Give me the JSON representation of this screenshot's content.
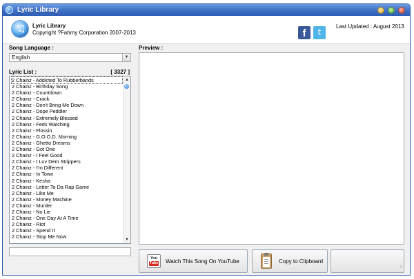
{
  "window": {
    "title": "Lyric Library"
  },
  "header": {
    "app_name": "Lyric Library",
    "copyright": "Copyright ?Fahmy Corporation 2007-2013",
    "facebook_glyph": "f",
    "twitter_glyph": "t",
    "last_updated": "Last Updated : August 2013"
  },
  "colors": {
    "title_bar": "#3d6fc6",
    "facebook": "#3b5998",
    "twitter": "#4fb4e8",
    "youtube_red": "#d62b22"
  },
  "icons": [
    "app-music-icon",
    "facebook-icon",
    "twitter-icon",
    "youtube-icon",
    "clipboard-icon",
    "minimize-icon",
    "maximize-icon",
    "close-icon"
  ],
  "language": {
    "label": "Song Language :",
    "selected": "English"
  },
  "lyric_list": {
    "label": "Lyric List :",
    "count": "[ 3327 ]",
    "items": [
      "2 Chainz - Addicted To Rubberbands",
      "2 Chainz - Birthday Song",
      "2 Chainz - Countdown",
      "2 Chainz - Crack",
      "2 Chainz - Don't Bring Me Down",
      "2 Chainz - Dope Peddler",
      "2 Chainz - Extremely Blessed",
      "2 Chainz - Feds Watching",
      "2 Chainz - Flossin",
      "2 Chainz - G.O.O.D. Morning",
      "2 Chainz - Ghetto Dreams",
      "2 Chainz - Got One",
      "2 Chainz - I Feel Good",
      "2 Chainz - I Luv Dem Strippers",
      "2 Chainz - I'm Different",
      "2 Chainz - In Town",
      "2 Chainz - Kesha",
      "2 Chainz - Letter To Da Rap Game",
      "2 Chainz - Like Me",
      "2 Chainz - Money Machine",
      "2 Chainz - Murder",
      "2 Chainz - No Lie",
      "2 Chainz - One Day At A Time",
      "2 Chainz - Riot",
      "2 Chainz - Spend It",
      "2 Chainz - Stop Me Now"
    ]
  },
  "search": {
    "value": ""
  },
  "preview": {
    "label": "Preview :",
    "content": ""
  },
  "buttons": {
    "youtube_label": "Watch This Song On YouTube",
    "youtube_icon_top": "You",
    "youtube_icon_bottom": "Tube",
    "clipboard_label": "Copy to Clipboard",
    "extra_label": ""
  }
}
